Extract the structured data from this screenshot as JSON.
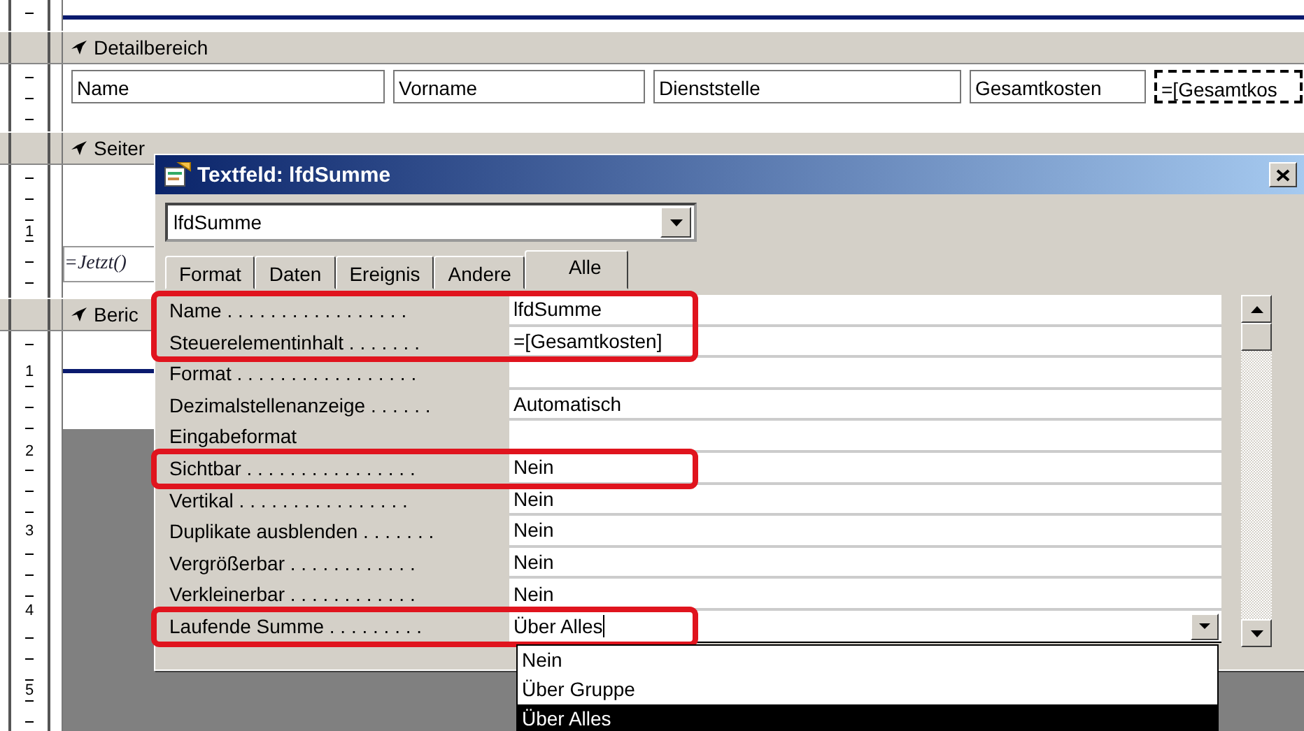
{
  "sections": [
    {
      "kind": "top"
    },
    {
      "kind": "bar",
      "title": "Detailbereich"
    },
    {
      "kind": "fields",
      "fields": [
        {
          "text": "Name",
          "selected": false
        },
        {
          "text": "Vorname",
          "selected": false
        },
        {
          "text": "Dienststelle",
          "selected": false
        },
        {
          "text": "Gesamtkosten",
          "selected": false
        },
        {
          "text": "=[Gesamtkos",
          "selected": true
        }
      ]
    },
    {
      "kind": "bar",
      "title": "Seiter"
    },
    {
      "kind": "footer",
      "ruler": [
        "1"
      ],
      "field": "=Jetzt()"
    },
    {
      "kind": "bar",
      "title": "Beric"
    },
    {
      "kind": "report",
      "ruler": [
        "1",
        "2",
        "3",
        "4",
        "5"
      ]
    }
  ],
  "dialog": {
    "title": "Textfeld: lfdSumme",
    "object_combo": "lfdSumme",
    "tabs": [
      {
        "label": "Format",
        "selected": false
      },
      {
        "label": "Daten",
        "selected": false
      },
      {
        "label": "Ereignis",
        "selected": false
      },
      {
        "label": "Andere",
        "selected": false
      },
      {
        "label": "Alle",
        "selected": true
      }
    ],
    "groups": [
      {
        "highlighted": true,
        "rows": [
          {
            "label": "Name . . . . . . . . . . . . . . . . .",
            "value": "lfdSumme"
          },
          {
            "label": "Steuerelementinhalt . . . . . . .",
            "value": "=[Gesamtkosten]"
          }
        ]
      },
      {
        "highlighted": false,
        "rows": [
          {
            "label": "Format . . . . . . . . . . . . . . . . .",
            "value": ""
          },
          {
            "label": "Dezimalstellenanzeige . . . . . .",
            "value": "Automatisch"
          },
          {
            "label": "Eingabeformat",
            "value": ""
          }
        ]
      },
      {
        "highlighted": true,
        "rows": [
          {
            "label": "Sichtbar . . . . . . . . . . . . . . . .",
            "value": "Nein"
          }
        ]
      },
      {
        "highlighted": false,
        "rows": [
          {
            "label": "Vertikal . . . . . . . . . . . . . . . .",
            "value": "Nein"
          },
          {
            "label": "Duplikate ausblenden . . . . . . .",
            "value": "Nein"
          },
          {
            "label": "Vergrößerbar . . . . . . . . . . . .",
            "value": "Nein"
          },
          {
            "label": "Verkleinerbar . . . . . . . . . . . .",
            "value": "Nein"
          }
        ]
      },
      {
        "highlighted": true,
        "rows": [
          {
            "label": "Laufende Summe . . . . . . . . .",
            "value": "Über Alles",
            "kind": "dropdown"
          }
        ]
      }
    ],
    "dropdown_options": [
      {
        "label": "Nein",
        "selected": false
      },
      {
        "label": "Über Gruppe",
        "selected": false
      },
      {
        "label": "Über Alles",
        "selected": true
      }
    ]
  }
}
